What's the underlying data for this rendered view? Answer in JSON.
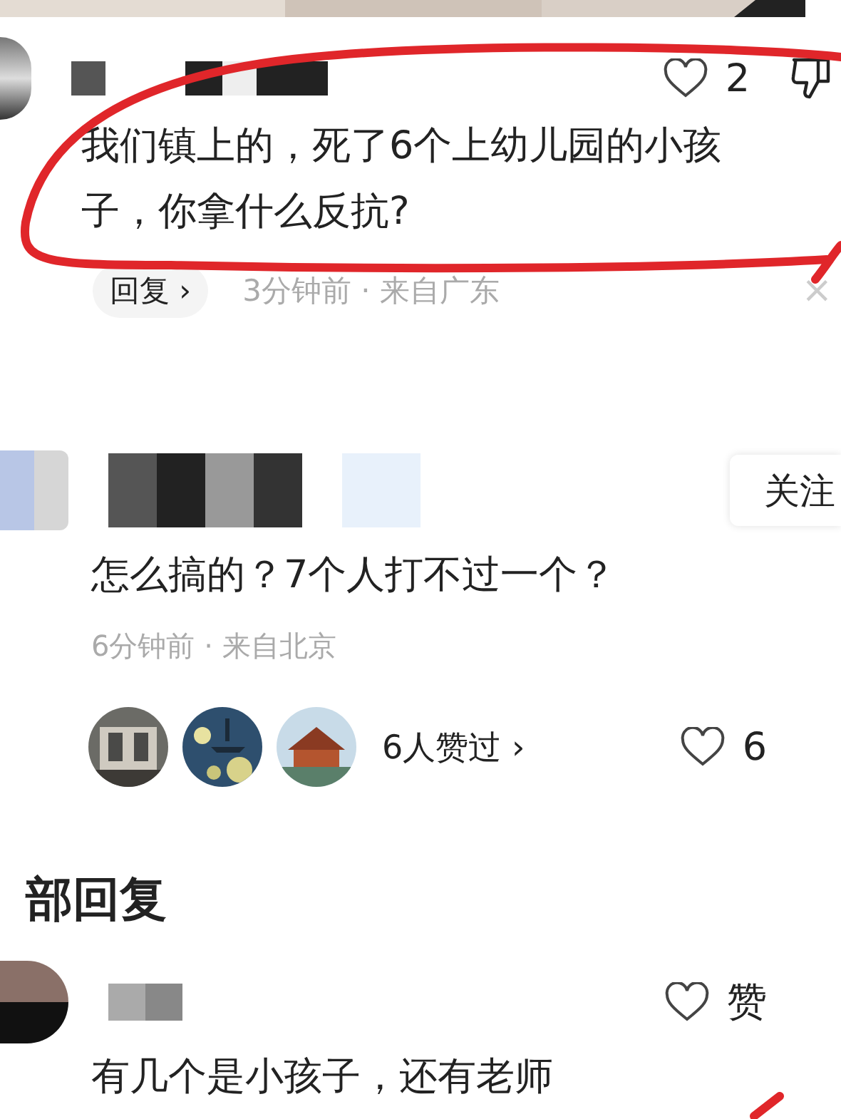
{
  "comment": {
    "likes": "2",
    "text": "我们镇上的，死了6个上幼儿园的小孩子，你拿什么反抗?",
    "reply_button": "回复 ›",
    "meta": "3分钟前 · 来自广东",
    "close": "×",
    "highlighted": true
  },
  "reply": {
    "follow_button": "关注",
    "text": "怎么搞的？7个人打不过一个？",
    "meta": "6分钟前 · 来自北京",
    "liked_by": "6人赞过 ›",
    "likes": "6"
  },
  "section_title": "部回复",
  "sub_reply": {
    "like_label": "赞",
    "text": "有几个是小孩子，还有老师"
  }
}
